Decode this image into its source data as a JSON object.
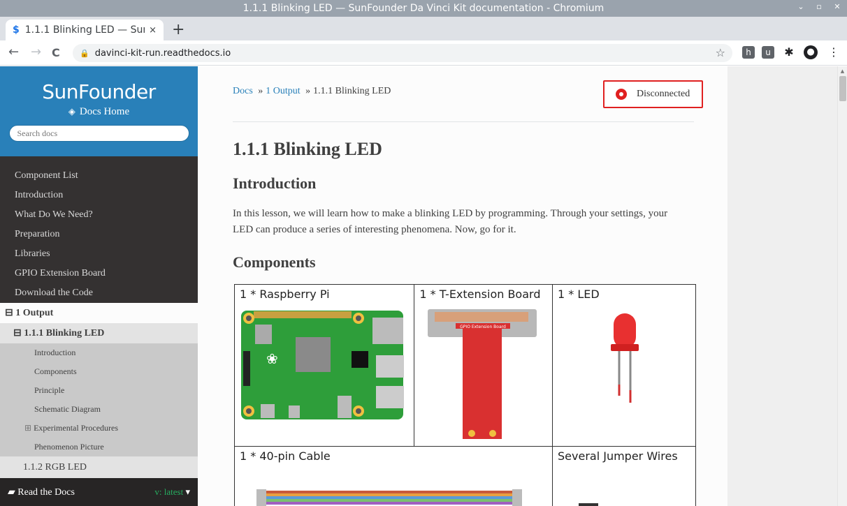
{
  "window": {
    "title": "1.1.1 Blinking LED — SunFounder Da Vinci Kit documentation - Chromium",
    "controls": [
      "⌄",
      "▫",
      "✕"
    ]
  },
  "tab": {
    "title": "1.1.1 Blinking LED — Sun",
    "close": "×",
    "new": "+"
  },
  "toolbar": {
    "back": "←",
    "forward": "→",
    "reload": "C",
    "url": "davinci-kit-run.readthedocs.io",
    "ext1": "h",
    "ext2": "u",
    "menu": "⋮"
  },
  "sidebar": {
    "logo": "SunFounder",
    "docs_home": "Docs Home",
    "search_placeholder": "Search docs",
    "items": [
      "Component List",
      "Introduction",
      "What Do We Need?",
      "Preparation",
      "Libraries",
      "GPIO Extension Board",
      "Download the Code"
    ],
    "current_section": "⊟ 1 Output",
    "current_page": "⊟ 1.1.1 Blinking LED",
    "subitems": [
      "Introduction",
      "Components",
      "Principle",
      "Schematic Diagram",
      "Experimental Procedures",
      "Phenomenon Picture"
    ],
    "expander": "⊞",
    "next_page": "1.1.2 RGB LED",
    "rtd_label": "Read the Docs",
    "version": "v: latest"
  },
  "breadcrumb": {
    "docs": "Docs",
    "sep": "»",
    "section": "1 Output",
    "page": "1.1.1 Blinking LED"
  },
  "status": {
    "label": "Disconnected",
    "color": "#e02020"
  },
  "content": {
    "title": "1.1.1 Blinking LED",
    "intro_heading": "Introduction",
    "intro_text": "In this lesson, we will learn how to make a blinking LED by programming. Through your settings, your LED can produce a series of interesting phenomena. Now, go for it.",
    "components_heading": "Components",
    "components": [
      "1 * Raspberry Pi",
      "1 * T-Extension Board",
      "1 * LED",
      "1 * 40-pin Cable",
      "Several Jumper Wires"
    ],
    "board_label": "GPIO Extension Board"
  }
}
